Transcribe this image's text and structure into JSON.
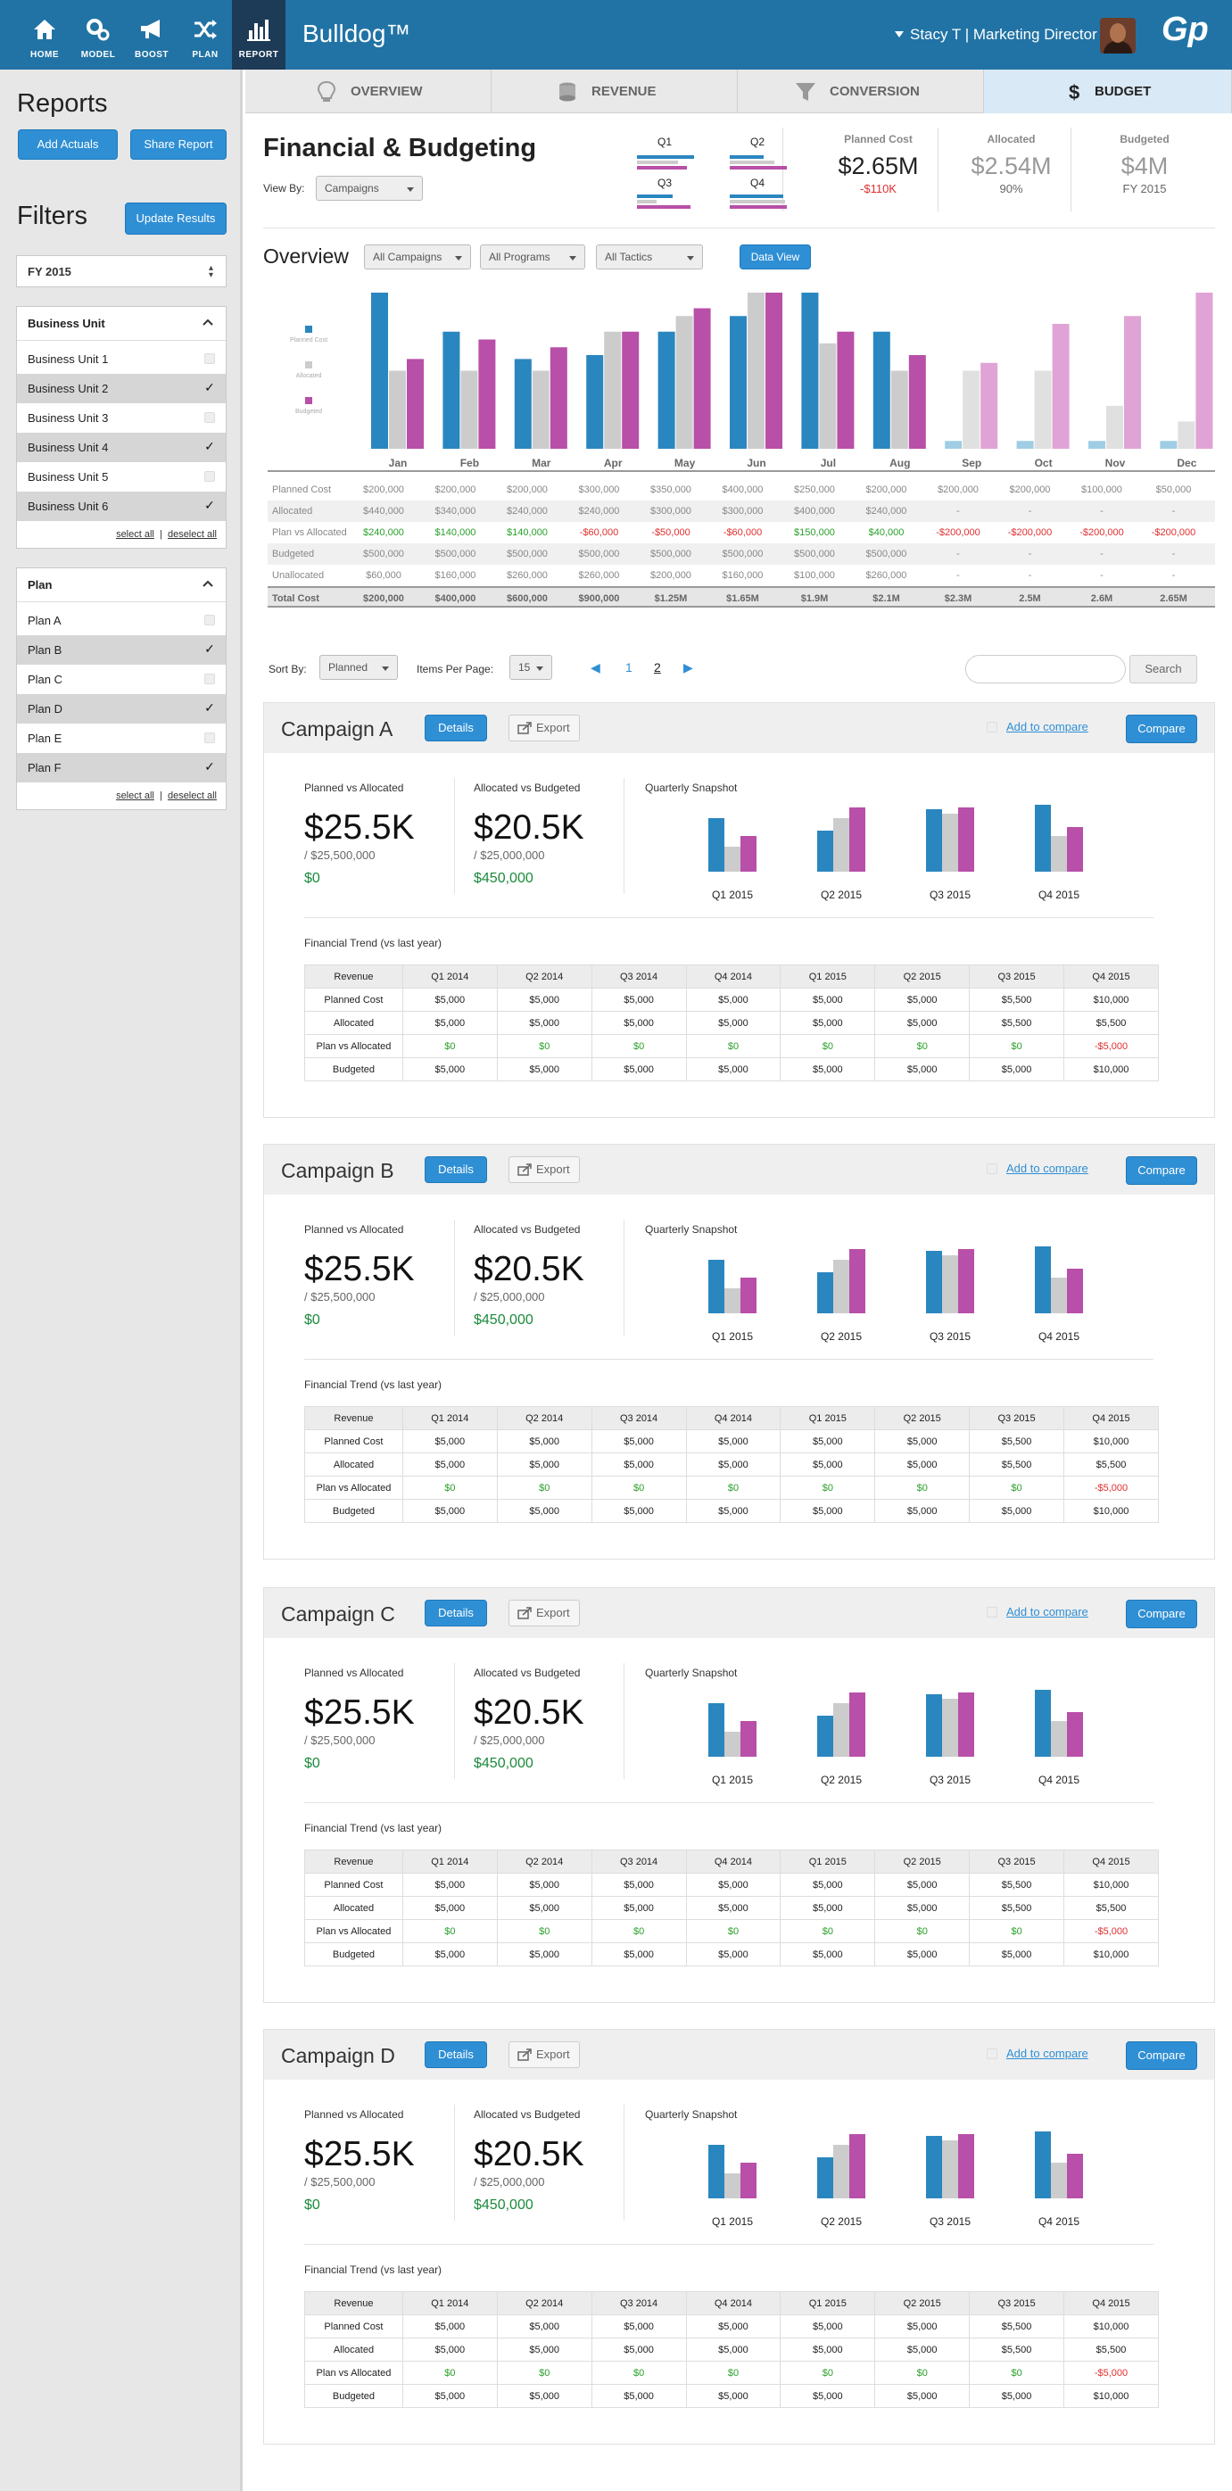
{
  "nav": {
    "items": [
      {
        "label": "HOME",
        "icon": "home-icon"
      },
      {
        "label": "MODEL",
        "icon": "gears-icon"
      },
      {
        "label": "BOOST",
        "icon": "megaphone-icon"
      },
      {
        "label": "PLAN",
        "icon": "shuffle-icon"
      },
      {
        "label": "REPORT",
        "icon": "bar-chart-icon",
        "active": true
      }
    ],
    "brand": "Bulldog™",
    "user": "Stacy T  |  Marketing Director",
    "logo": "Gp"
  },
  "sidebar": {
    "reports_title": "Reports",
    "add_actuals": "Add Actuals",
    "share_report": "Share Report",
    "filters_title": "Filters",
    "update_results": "Update Results",
    "fiscal_year": "FY 2015",
    "business_unit": {
      "title": "Business Unit",
      "items": [
        {
          "label": "Business Unit 1",
          "checked": false
        },
        {
          "label": "Business Unit 2",
          "checked": true
        },
        {
          "label": "Business Unit 3",
          "checked": false
        },
        {
          "label": "Business Unit 4",
          "checked": true
        },
        {
          "label": "Business Unit 5",
          "checked": false
        },
        {
          "label": "Business Unit 6",
          "checked": true
        }
      ],
      "select_all": "select all",
      "deselect_all": "deselect all"
    },
    "plan": {
      "title": "Plan",
      "items": [
        {
          "label": "Plan A",
          "checked": false
        },
        {
          "label": "Plan B",
          "checked": true
        },
        {
          "label": "Plan C",
          "checked": false
        },
        {
          "label": "Plan D",
          "checked": true
        },
        {
          "label": "Plan E",
          "checked": false
        },
        {
          "label": "Plan F",
          "checked": true
        }
      ],
      "select_all": "select all",
      "deselect_all": "deselect all"
    }
  },
  "tabs": [
    {
      "label": "OVERVIEW",
      "icon": "lightbulb-icon"
    },
    {
      "label": "REVENUE",
      "icon": "coins-icon"
    },
    {
      "label": "CONVERSION",
      "icon": "funnel-icon"
    },
    {
      "label": "BUDGET",
      "icon": "dollar-icon",
      "active": true
    }
  ],
  "header": {
    "title": "Financial & Budgeting",
    "view_by_label": "View By:",
    "view_by_value": "Campaigns",
    "quarters": [
      "Q1",
      "Q2",
      "Q3",
      "Q4"
    ],
    "kpis": {
      "planned_cost": {
        "label": "Planned Cost",
        "value": "$2.65M",
        "sub": "-$110K"
      },
      "allocated": {
        "label": "Allocated",
        "value": "$2.54M",
        "sub": "90%"
      },
      "budgeted": {
        "label": "Budgeted",
        "value": "$4M",
        "sub": "FY 2015"
      }
    }
  },
  "overview": {
    "title": "Overview",
    "filter_campaigns": "All Campaigns",
    "filter_programs": "All Programs",
    "filter_tactics": "All Tactics",
    "data_view": "Data View",
    "legend": [
      "Planned Cost",
      "Allocated",
      "Budgeted"
    ],
    "rows": [
      {
        "label": "Planned Cost",
        "values": [
          "$200,000",
          "$200,000",
          "$200,000",
          "$300,000",
          "$350,000",
          "$400,000",
          "$250,000",
          "$200,000",
          "$200,000",
          "$200,000",
          "$100,000",
          "$50,000"
        ]
      },
      {
        "label": "Allocated",
        "values": [
          "$440,000",
          "$340,000",
          "$240,000",
          "$240,000",
          "$300,000",
          "$300,000",
          "$400,000",
          "$240,000",
          "-",
          "-",
          "-",
          "-"
        ]
      },
      {
        "label": "Plan vs Allocated",
        "values": [
          "$240,000",
          "$140,000",
          "$140,000",
          "-$60,000",
          "-$50,000",
          "-$60,000",
          "$150,000",
          "$40,000",
          "-$200,000",
          "-$200,000",
          "-$200,000",
          "-$200,000"
        ]
      },
      {
        "label": "Budgeted",
        "values": [
          "$500,000",
          "$500,000",
          "$500,000",
          "$500,000",
          "$500,000",
          "$500,000",
          "$500,000",
          "$500,000",
          "-",
          "-",
          "-",
          "-"
        ]
      },
      {
        "label": "Unallocated",
        "values": [
          "$60,000",
          "$160,000",
          "$260,000",
          "$260,000",
          "$200,000",
          "$160,000",
          "$100,000",
          "$260,000",
          "-",
          "-",
          "-",
          "-"
        ]
      },
      {
        "label": "Total Cost",
        "values": [
          "$200,000",
          "$400,000",
          "$600,000",
          "$900,000",
          "$1.25M",
          "$1.65M",
          "$1.9M",
          "$2.1M",
          "$2.3M",
          "2.5M",
          "2.6M",
          "2.65M"
        ]
      }
    ]
  },
  "chart_data": {
    "type": "bar",
    "categories": [
      "Jan",
      "Feb",
      "Mar",
      "Apr",
      "May",
      "Jun",
      "Jul",
      "Aug",
      "Sep",
      "Oct",
      "Nov",
      "Dec"
    ],
    "series": [
      {
        "name": "Planned Cost",
        "values": [
          200000,
          150000,
          115000,
          120000,
          150000,
          170000,
          200000,
          150000,
          10000,
          10000,
          10000,
          10000
        ]
      },
      {
        "name": "Allocated",
        "values": [
          100000,
          100000,
          100000,
          150000,
          170000,
          200000,
          135000,
          100000,
          100000,
          100000,
          55000,
          35000
        ]
      },
      {
        "name": "Budgeted",
        "values": [
          115000,
          140000,
          130000,
          150000,
          180000,
          200000,
          150000,
          120000,
          110000,
          160000,
          170000,
          200000
        ]
      }
    ],
    "ylim": [
      0,
      200000
    ],
    "future_from_index": 8,
    "colors": {
      "Planned Cost": "#2a86bf",
      "Allocated": "#cccccc",
      "Budgeted": "#b84fa8"
    }
  },
  "sort": {
    "sort_by_label": "Sort By:",
    "sort_by_value": "Planned",
    "per_page_label": "Items Per Page:",
    "per_page_value": "15",
    "pages": [
      "1",
      "2"
    ],
    "search_placeholder": "",
    "search_button": "Search"
  },
  "campaigns": [
    {
      "name": "Campaign A"
    },
    {
      "name": "Campaign B"
    },
    {
      "name": "Campaign C"
    },
    {
      "name": "Campaign D"
    }
  ],
  "campaign_common": {
    "details": "Details",
    "export": "Export",
    "add_to_compare": "Add to compare",
    "compare": "Compare",
    "pa_label": "Planned vs Allocated",
    "pa_value": "$25.5K",
    "pa_sub": "/ $25,500,000",
    "pa_delta": "$0",
    "ab_label": "Allocated vs Budgeted",
    "ab_value": "$20.5K",
    "ab_sub": "/ $25,000,000",
    "ab_delta": "$450,000",
    "qs_label": "Quarterly Snapshot",
    "qs_quarters": [
      "Q1 2015",
      "Q2 2015",
      "Q3 2015",
      "Q4 2015"
    ],
    "qs_values": [
      [
        60,
        28,
        40
      ],
      [
        46,
        60,
        72
      ],
      [
        70,
        65,
        72
      ],
      [
        75,
        40,
        50
      ]
    ],
    "ft_label": "Financial Trend (vs last year)",
    "table": {
      "header": [
        "Revenue",
        "Q1 2014",
        "Q2 2014",
        "Q3 2014",
        "Q4 2014",
        "Q1 2015",
        "Q2 2015",
        "Q3 2015",
        "Q4 2015"
      ],
      "rows": [
        [
          "Planned Cost",
          "$5,000",
          "$5,000",
          "$5,000",
          "$5,000",
          "$5,000",
          "$5,000",
          "$5,500",
          "$10,000"
        ],
        [
          "Allocated",
          "$5,000",
          "$5,000",
          "$5,000",
          "$5,000",
          "$5,000",
          "$5,000",
          "$5,500",
          "$5,500"
        ],
        [
          "Plan vs Allocated",
          "$0",
          "$0",
          "$0",
          "$0",
          "$0",
          "$0",
          "$0",
          "-$5,000"
        ],
        [
          "Budgeted",
          "$5,000",
          "$5,000",
          "$5,000",
          "$5,000",
          "$5,000",
          "$5,000",
          "$5,000",
          "$10,000"
        ]
      ]
    }
  }
}
